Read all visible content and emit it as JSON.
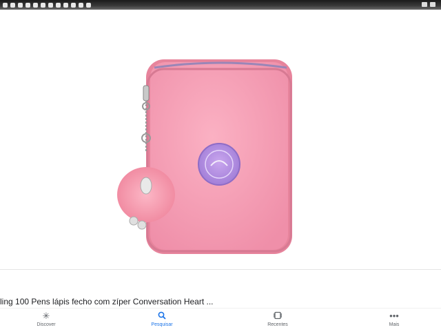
{
  "caption": "ling 100 Pens lápis fecho com zíper Conversation Heart ...",
  "nav": [
    {
      "label": "Discover",
      "icon": "asterisk-icon"
    },
    {
      "label": "Pesquisar",
      "icon": "search-icon",
      "active": true
    },
    {
      "label": "Recentes",
      "icon": "recents-icon"
    },
    {
      "label": "Mais",
      "icon": "more-dots-icon"
    }
  ],
  "colors": {
    "accent": "#1a73e8",
    "case_pink": "#f39ab0",
    "badge_purple": "#b48fe0"
  }
}
